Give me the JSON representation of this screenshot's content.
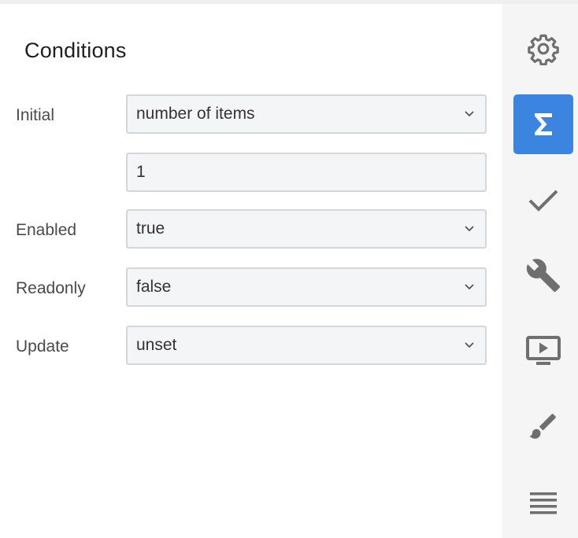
{
  "panel": {
    "title": "Conditions"
  },
  "rows": {
    "initial": {
      "label": "Initial",
      "value": "number of items"
    },
    "initial_count": {
      "value": "1"
    },
    "enabled": {
      "label": "Enabled",
      "value": "true"
    },
    "readonly": {
      "label": "Readonly",
      "value": "false"
    },
    "update": {
      "label": "Update",
      "value": "unset"
    }
  },
  "sidebar": {
    "active_item": "sigma-icon",
    "items": [
      "gear-icon",
      "sigma-icon",
      "check-icon",
      "wrench-icon",
      "preview-icon",
      "brush-icon",
      "menu-icon"
    ],
    "accent_color": "#3b84df",
    "icon_color": "#6f6f6f"
  }
}
